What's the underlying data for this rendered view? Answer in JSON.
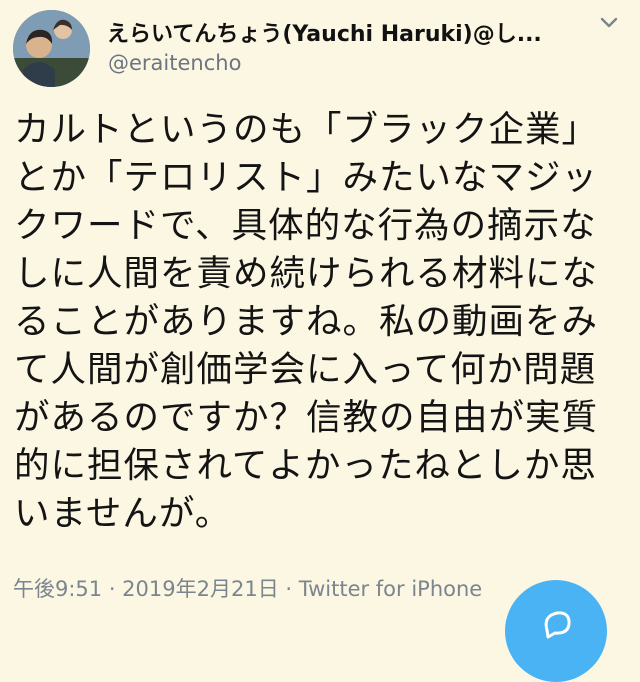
{
  "tweet": {
    "author_name": "えらいてんちょう(Yauchi Haruki)@し...",
    "handle": "@eraitencho",
    "text": "カルトというのも「ブラック企業」とか「テロリスト」みたいなマジックワードで、具体的な行為の摘示なしに人間を責め続けられる材料になることがありますね。私の動画をみて人間が創価学会に入って何か問題があるのですか？信教の自由が実質的に担保されてよかったねとしか思いませんが。",
    "timestamp": "午後9:51 · 2019年2月21日 · Twitter for iPhone"
  },
  "icons": {
    "menu": "chevron-down-icon",
    "compose": "compose-icon"
  },
  "colors": {
    "background": "#fcf7e3",
    "accent": "#4ab3f4",
    "secondary_text": "#6b7680"
  }
}
